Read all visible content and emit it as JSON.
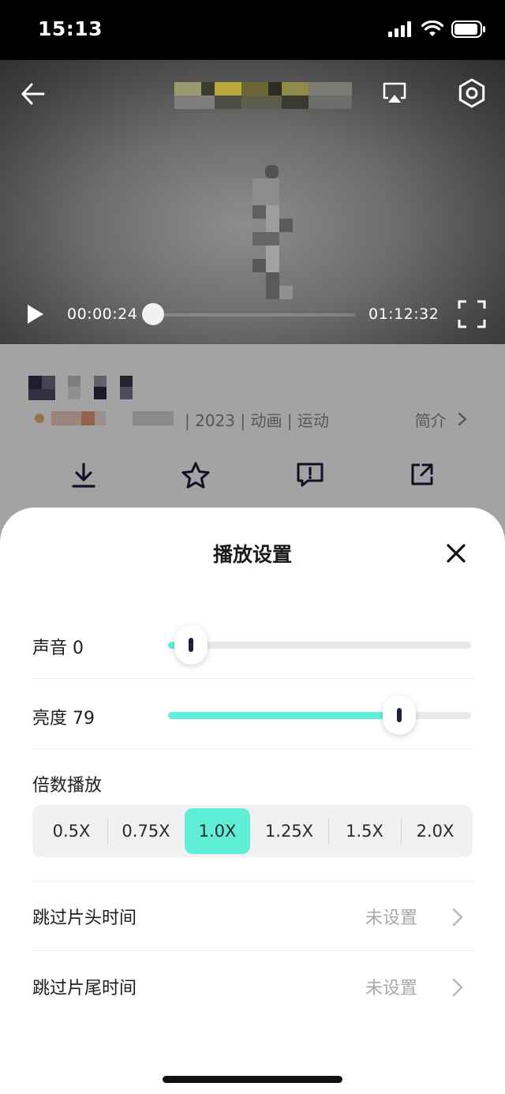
{
  "status_bar": {
    "time": "15:13",
    "icons": [
      "signal-icon",
      "wifi-icon",
      "battery-icon"
    ]
  },
  "video": {
    "current_time": "00:00:24",
    "duration": "01:12:32",
    "progress": 0.0055,
    "icons": [
      "back-arrow-icon",
      "airplay-icon",
      "gear-icon",
      "play-icon",
      "fullscreen-icon"
    ]
  },
  "details": {
    "meta": "| 2023 | 动画 | 运动",
    "intro_label": "简介",
    "actions": [
      {
        "icon": "download-icon",
        "label": ""
      },
      {
        "icon": "star-icon",
        "label": ""
      },
      {
        "icon": "feedback-icon",
        "label": ""
      },
      {
        "icon": "share-icon",
        "label": ""
      }
    ]
  },
  "settings_sheet": {
    "title": "播放设置",
    "volume": {
      "label": "声音 0",
      "value": 0
    },
    "brightness": {
      "label": "亮度 79",
      "value": 79
    },
    "speed": {
      "label": "倍数播放",
      "options": [
        "0.5X",
        "0.75X",
        "1.0X",
        "1.25X",
        "1.5X",
        "2.0X"
      ],
      "selected": "1.0X"
    },
    "skip_intro": {
      "label": "跳过片头时间",
      "value": "未设置"
    },
    "skip_outro": {
      "label": "跳过片尾时间",
      "value": "未设置"
    }
  },
  "colors": {
    "accent": "#5FEFD7",
    "dim_overlay": "rgba(0,0,0,0.36)",
    "text_primary": "#1D1D1D",
    "text_muted": "#A8A8A8"
  }
}
